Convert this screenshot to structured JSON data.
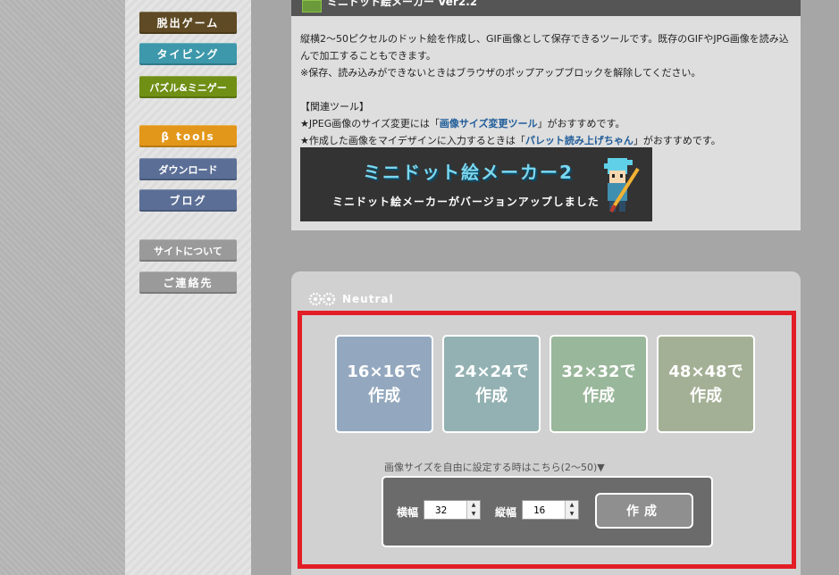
{
  "sidebar": {
    "items": [
      {
        "label": "脱出ゲーム",
        "color": "#5e4a24"
      },
      {
        "label": "タイピング",
        "color": "#3c98aa"
      },
      {
        "label": "パズル&ミニゲー",
        "color": "#6f8f15"
      },
      {
        "label": "β tools",
        "color": "#e3971a"
      },
      {
        "label": "ダウンロード",
        "color": "#5b6f96"
      },
      {
        "label": "ブログ",
        "color": "#5b6f96"
      },
      {
        "label": "サイトについて",
        "color": "#9a9a9a"
      },
      {
        "label": "ご連絡先",
        "color": "#9a9a9a"
      }
    ]
  },
  "tool": {
    "header_title": "ミニドット絵メーカー Ver2.2",
    "desc_line1": "縦横2〜50ピクセルのドット絵を作成し、GIF画像として保存できるツールです。既存のGIFやJPG画像を読み込",
    "desc_line2": "んで加工することもできます。",
    "desc_line3": "※保存、読み込みができないときはブラウザのポップアップブロックを解除してください。",
    "related_heading": "【関連ツール】",
    "related1_prefix": "★JPEG画像のサイズ変更には「",
    "related1_link": "画像サイズ変更ツール",
    "related1_suffix": "」がおすすめです。",
    "related2_prefix": "★作成した画像をマイデザインに入力するときは「",
    "related2_link": "パレット読み上げちゃん",
    "related2_suffix": "」がおすすめです。",
    "banner_title": "ミニドット絵メーカー2",
    "banner_subtitle": "ミニドット絵メーカーがバージョンアップしました"
  },
  "neutral": {
    "title": "Neutral",
    "size_buttons": [
      {
        "line1": "16×16で",
        "line2": "作成",
        "color": "#93a8be"
      },
      {
        "line1": "24×24で",
        "line2": "作成",
        "color": "#93b1b2"
      },
      {
        "line1": "32×32で",
        "line2": "作成",
        "color": "#99b79a"
      },
      {
        "line1": "48×48で",
        "line2": "作成",
        "color": "#a4b095"
      }
    ],
    "free_size_label": "画像サイズを自由に設定する時はこちら(2〜50)▼",
    "width_label": "横幅",
    "width_value": "32",
    "height_label": "縦幅",
    "height_value": "16",
    "create_label": "作成"
  }
}
